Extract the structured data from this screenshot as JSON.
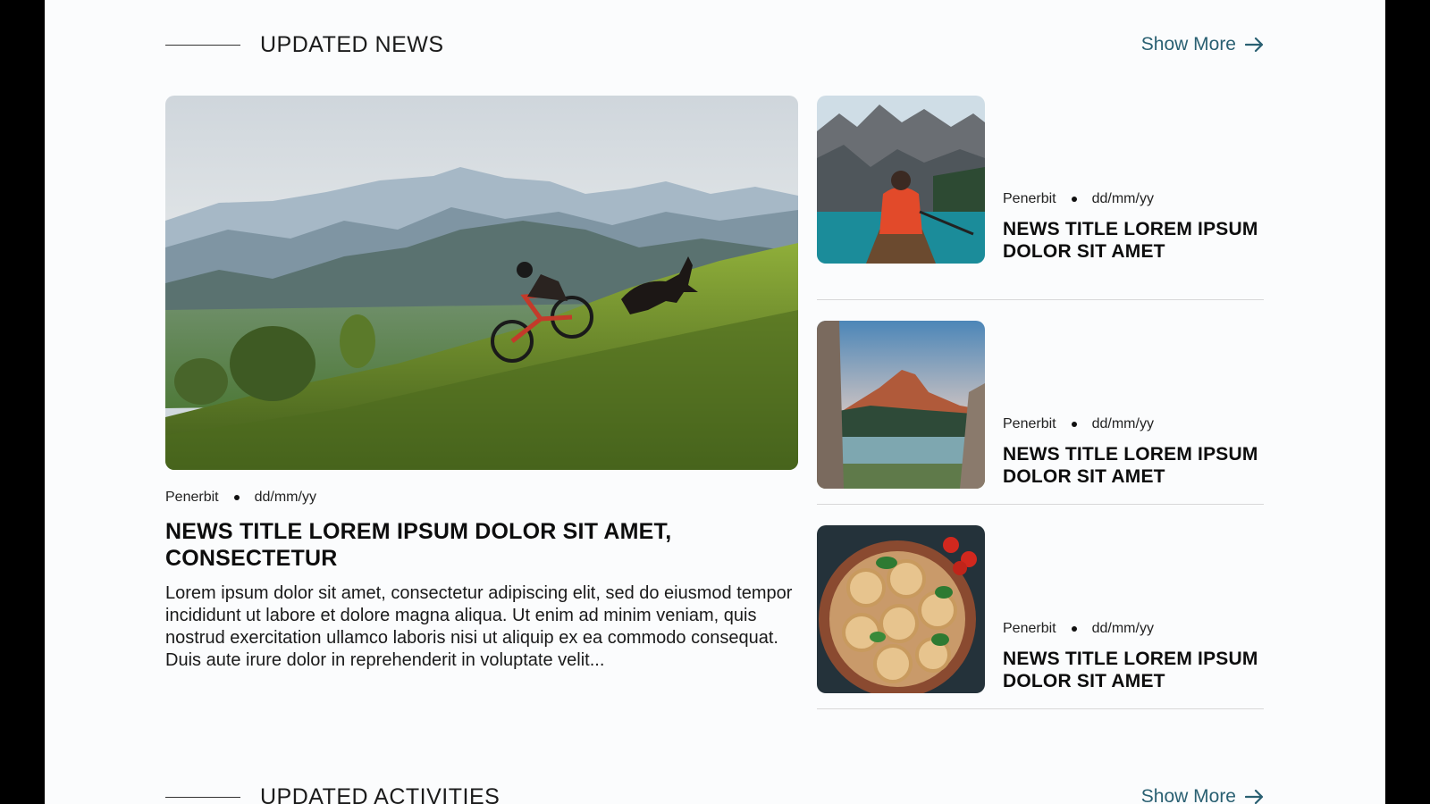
{
  "news_section": {
    "title": "UPDATED NEWS",
    "show_more": "Show More"
  },
  "featured": {
    "publisher": "Penerbit",
    "date": "dd/mm/yy",
    "headline": "NEWS TITLE LOREM IPSUM DOLOR SIT AMET, CONSECTETUR",
    "excerpt": "Lorem ipsum dolor sit amet, consectetur adipiscing elit, sed do eiusmod tempor incididunt ut labore et dolore magna aliqua. Ut enim ad minim veniam, quis nostrud exercitation ullamco laboris nisi ut aliquip ex ea commodo consequat. Duis aute irure dolor in reprehenderit in voluptate velit...",
    "image_icon": "mountain-biker-photo"
  },
  "side_news": [
    {
      "publisher": "Penerbit",
      "date": "dd/mm/yy",
      "headline": "NEWS TITLE LOREM IPSUM DOLOR SIT AMET",
      "image_icon": "canoe-lake-photo"
    },
    {
      "publisher": "Penerbit",
      "date": "dd/mm/yy",
      "headline": "NEWS TITLE LOREM IPSUM DOLOR SIT AMET",
      "image_icon": "mountain-lake-photo"
    },
    {
      "publisher": "Penerbit",
      "date": "dd/mm/yy",
      "headline": "NEWS TITLE LOREM IPSUM DOLOR SIT AMET",
      "image_icon": "pasta-dish-photo"
    }
  ],
  "activities_section": {
    "title": "UPDATED ACTIVITIES",
    "show_more": "Show More"
  },
  "colors": {
    "accent": "#2a6072",
    "background": "#fbfcfd",
    "frame": "#000000"
  }
}
